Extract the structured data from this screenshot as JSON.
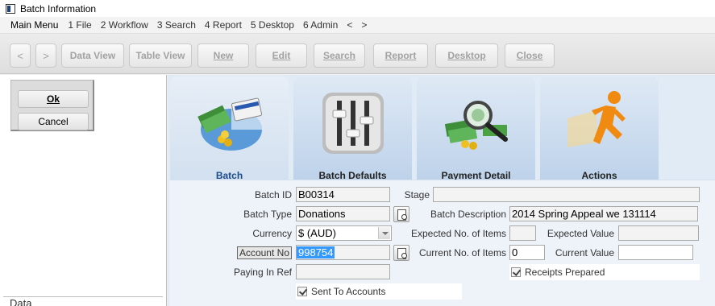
{
  "window": {
    "title": "Batch Information"
  },
  "menu": {
    "items": [
      "Main Menu",
      "1 File",
      "2 Workflow",
      "3 Search",
      "4 Report",
      "5 Desktop",
      "6 Admin",
      "<",
      ">"
    ]
  },
  "toolbar": {
    "back": "<",
    "forward": ">",
    "data_view": "Data View",
    "table_view": "Table View",
    "new": "New",
    "edit": "Edit",
    "search": "Search",
    "report": "Report",
    "desktop": "Desktop",
    "close": "Close"
  },
  "dialog": {
    "ok": "Ok",
    "cancel": "Cancel"
  },
  "left": {
    "section": "Data"
  },
  "tabs": [
    {
      "label": "Batch",
      "icon": "batch-money-card-icon",
      "active": true
    },
    {
      "label": "Batch Defaults",
      "icon": "sliders-icon",
      "active": false
    },
    {
      "label": "Payment Detail",
      "icon": "magnifier-money-icon",
      "active": false
    },
    {
      "label": "Actions",
      "icon": "running-man-icon",
      "active": false
    }
  ],
  "form": {
    "batch_id": {
      "label": "Batch ID",
      "value": "B00314"
    },
    "stage": {
      "label": "Stage",
      "value": ""
    },
    "batch_type": {
      "label": "Batch Type",
      "value": "Donations"
    },
    "batch_description": {
      "label": "Batch Description",
      "value": "2014 Spring Appeal we 131114"
    },
    "currency": {
      "label": "Currency",
      "value": "$ (AUD)"
    },
    "expected_items": {
      "label": "Expected No. of Items",
      "value": ""
    },
    "expected_value": {
      "label": "Expected Value",
      "value": ""
    },
    "account_no": {
      "label": "Account No",
      "value": "998754"
    },
    "current_items": {
      "label": "Current No. of Items",
      "value": "0"
    },
    "current_value": {
      "label": "Current Value",
      "value": ""
    },
    "paying_in_ref": {
      "label": "Paying In Ref",
      "value": ""
    },
    "receipts_prepared": {
      "label": "Receipts Prepared",
      "checked": true
    },
    "sent_to_accounts": {
      "label": "Sent To Accounts",
      "checked": true
    }
  },
  "colors": {
    "tab_bg": "#bdd2ea",
    "form_bg": "#eef3f9",
    "highlight": "#3399ff",
    "active_tab_text": "#1c4a8a"
  }
}
